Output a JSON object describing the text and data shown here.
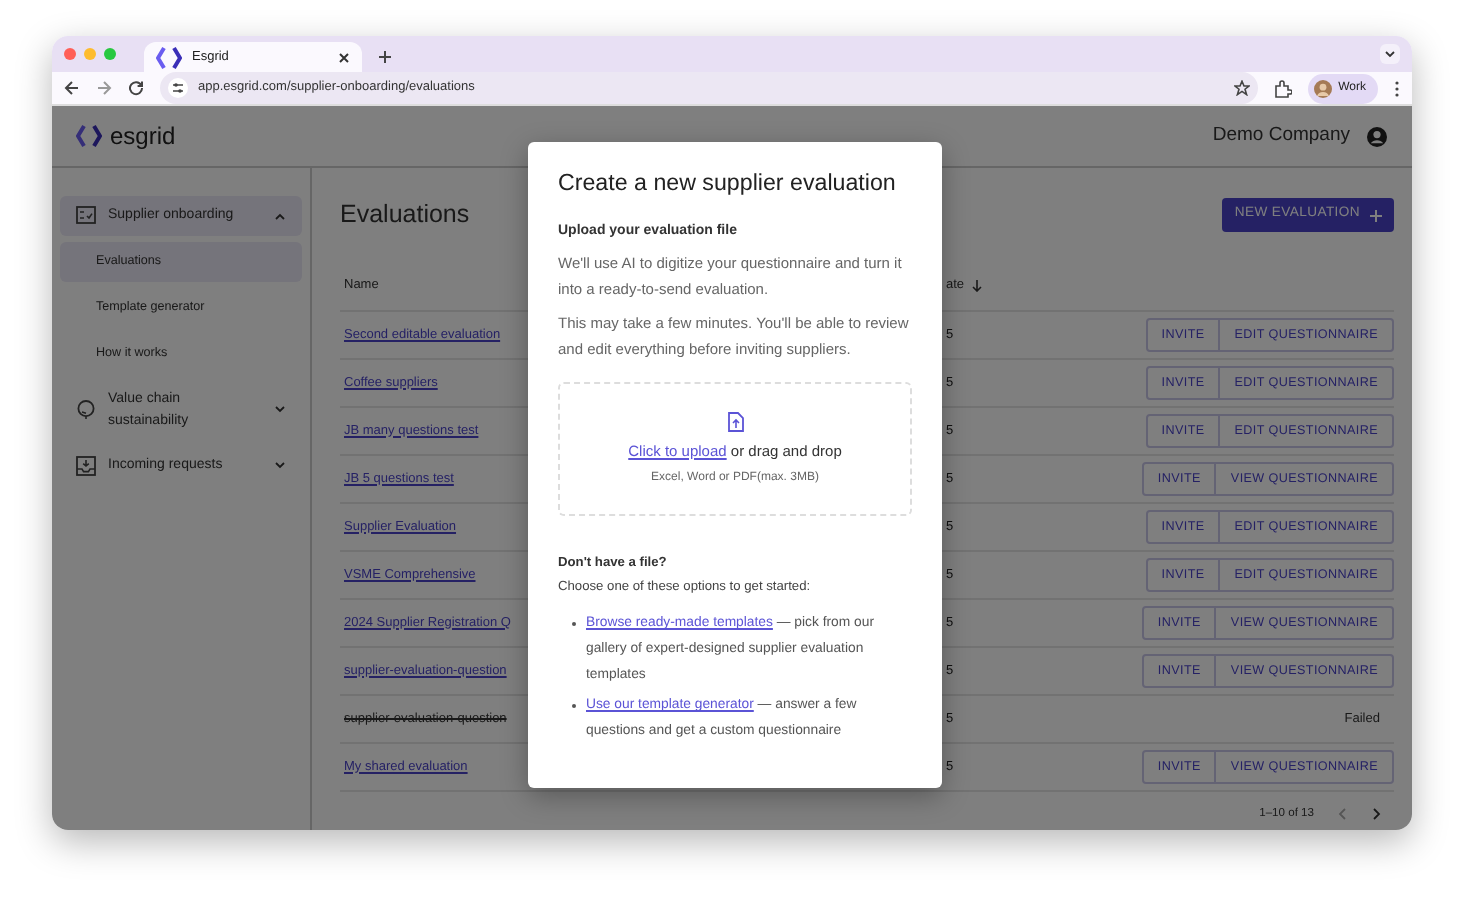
{
  "browser": {
    "tab_title": "Esgrid",
    "url": "app.esgrid.com/supplier-onboarding/evaluations",
    "profile": "Work"
  },
  "app": {
    "logo": "esgrid",
    "company": "Demo Company"
  },
  "sidebar": {
    "items": [
      {
        "label": "Supplier onboarding",
        "selected": true,
        "expanded": true,
        "children": [
          {
            "label": "Evaluations",
            "selected": true
          },
          {
            "label": "Template generator",
            "selected": false
          },
          {
            "label": "How it works",
            "selected": false
          }
        ]
      },
      {
        "label": "Value chain sustainability",
        "selected": false,
        "expanded": false
      },
      {
        "label": "Incoming requests",
        "selected": false,
        "expanded": false
      }
    ]
  },
  "page": {
    "title": "Evaluations",
    "new_button": "NEW EVALUATION"
  },
  "table": {
    "columns": [
      "Name",
      "ate"
    ],
    "rows": [
      {
        "name": "Second editable evaluation",
        "column_2": "5",
        "kind": "actions",
        "actions": [
          "INVITE",
          "EDIT QUESTIONNAIRE"
        ]
      },
      {
        "name": "Coffee suppliers",
        "column_2": "5",
        "kind": "actions",
        "actions": [
          "INVITE",
          "EDIT QUESTIONNAIRE"
        ]
      },
      {
        "name": "JB many questions test",
        "column_2": "5",
        "kind": "actions",
        "actions": [
          "INVITE",
          "EDIT QUESTIONNAIRE"
        ]
      },
      {
        "name": "JB 5 questions test",
        "column_2": "5",
        "kind": "actions",
        "actions": [
          "INVITE",
          "VIEW QUESTIONNAIRE"
        ]
      },
      {
        "name": "Supplier Evaluation",
        "column_2": "5",
        "kind": "actions",
        "actions": [
          "INVITE",
          "EDIT QUESTIONNAIRE"
        ]
      },
      {
        "name": "VSME Comprehensive",
        "column_2": "5",
        "kind": "actions",
        "actions": [
          "INVITE",
          "EDIT QUESTIONNAIRE"
        ]
      },
      {
        "name": "2024 Supplier Registration Q",
        "column_2": "5",
        "kind": "actions",
        "actions": [
          "INVITE",
          "VIEW QUESTIONNAIRE"
        ]
      },
      {
        "name": "supplier-evaluation-question",
        "column_2": "5",
        "kind": "actions",
        "actions": [
          "INVITE",
          "VIEW QUESTIONNAIRE"
        ]
      },
      {
        "name": "supplier-evaluation-question",
        "column_2": "5",
        "kind": "failed",
        "status": "Failed"
      },
      {
        "name": "My shared evaluation",
        "column_2": "5",
        "kind": "actions",
        "actions": [
          "INVITE",
          "VIEW QUESTIONNAIRE"
        ]
      }
    ],
    "pagination": {
      "range": "1–10 of 13",
      "prev_disabled": true,
      "next_disabled": false
    }
  },
  "modal": {
    "title": "Create a new supplier evaluation",
    "section_title": "Upload your evaluation file",
    "paragraphs": [
      "We'll use AI to digitize your questionnaire and turn it into a ready-to-send evaluation.",
      "This may take a few minutes. You'll be able to review and edit everything before inviting suppliers."
    ],
    "dropzone": {
      "link": "Click to upload",
      "text": "or drag and drop",
      "hint": "Excel, Word or PDF(max. 3MB)"
    },
    "alt_title": "Don't have a file?",
    "alt_text": "Choose one of these options to get started:",
    "options": [
      {
        "link": "Browse ready-made templates",
        "text": "— pick from our gallery of expert-designed supplier evaluation templates"
      },
      {
        "link": "Use our template generator",
        "text": "— answer a few questions and get a custom questionnaire"
      }
    ]
  }
}
